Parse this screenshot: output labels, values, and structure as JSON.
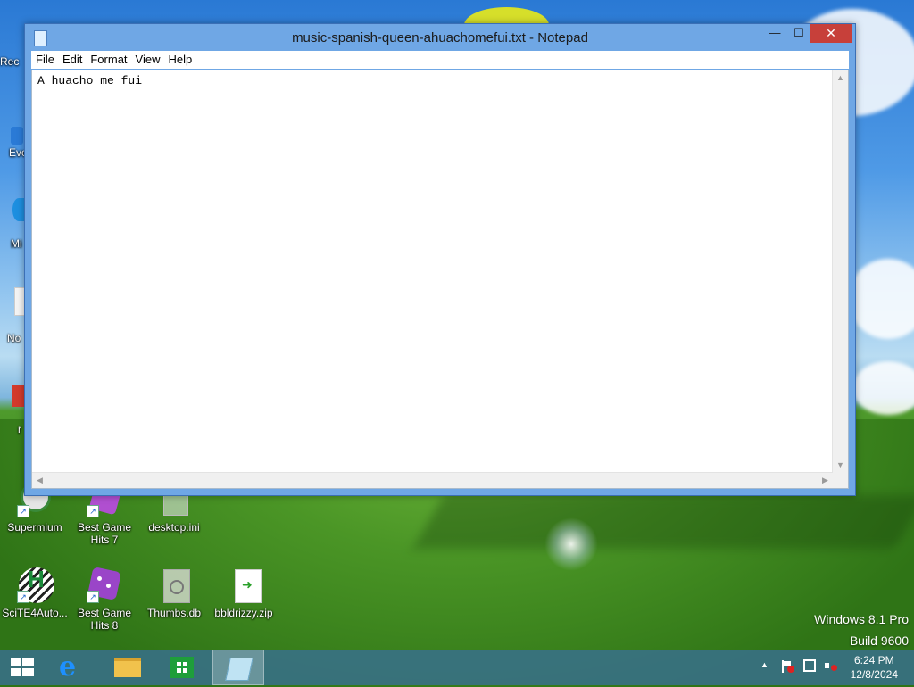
{
  "window": {
    "title": "music-spanish-queen-ahuachomefui.txt - Notepad",
    "minimize_glyph": "—",
    "maximize_glyph": "☐",
    "close_glyph": "✕",
    "menu": [
      "File",
      "Edit",
      "Format",
      "View",
      "Help"
    ],
    "content": "A huacho me fui"
  },
  "desktop_icons": [
    {
      "label": "Supermium",
      "icon": "supermium-icon"
    },
    {
      "label": "Best Game Hits 7",
      "icon": "dice-icon"
    },
    {
      "label": "desktop.ini",
      "icon": "settings-file-icon"
    },
    {
      "label": "SciTE4Auto...",
      "icon": "scite-icon"
    },
    {
      "label": "Best Game Hits 8",
      "icon": "dice-icon"
    },
    {
      "label": "Thumbs.db",
      "icon": "database-file-icon"
    },
    {
      "label": "bbldrizzy.zip",
      "icon": "zip-file-icon"
    }
  ],
  "left_partial_labels": [
    "Rec",
    "Eve",
    "Mi",
    "No",
    "r"
  ],
  "taskbar": {
    "items": [
      "start-icon",
      "internet-explorer-icon",
      "file-explorer-icon",
      "store-icon",
      "notepad-icon"
    ],
    "time": "6:24 PM",
    "date": "12/8/2024",
    "tray_chevron": "▲"
  },
  "watermark": {
    "line1": "Windows 8.1 Pro",
    "line2": "Build 9600"
  },
  "colors": {
    "window_frame": "#6fa7e5",
    "close_button": "#c7403a",
    "taskbar": "#38708c"
  }
}
